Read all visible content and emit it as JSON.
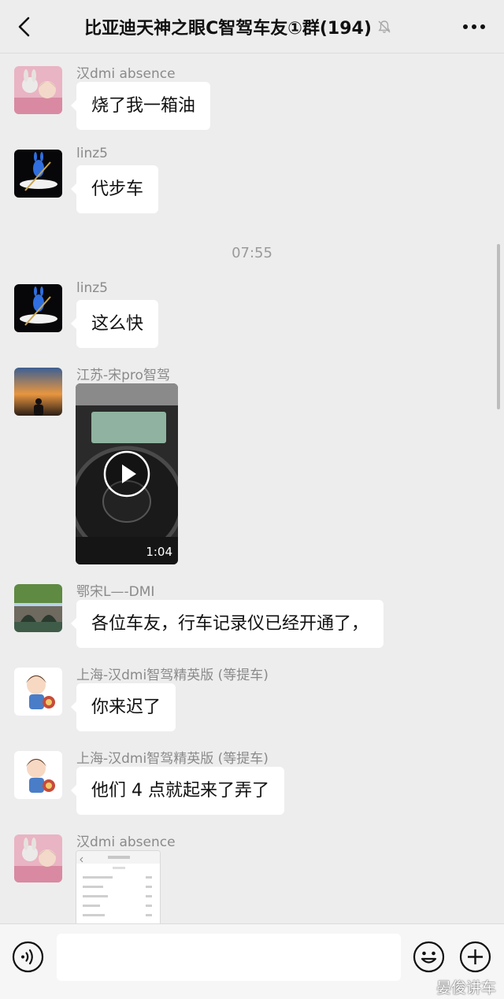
{
  "header": {
    "back_icon": "chevron-left-icon",
    "title": "比亚迪天神之眼C智驾车友①群(194)",
    "mute_icon": "bell-slash-icon",
    "more_icon": "ellipsis-icon"
  },
  "chat": {
    "messages": [
      {
        "sender": "汉dmi absence",
        "avatar": "cartoon-photo-avatar",
        "type": "text",
        "text": "烧了我一箱油"
      },
      {
        "sender": "linz5",
        "avatar": "blue-rabbit-avatar",
        "type": "text",
        "text": "代步车"
      },
      {
        "type": "time",
        "text": "07:55"
      },
      {
        "sender": "linz5",
        "avatar": "blue-rabbit-avatar",
        "type": "text",
        "text": "这么快"
      },
      {
        "sender": "江苏-宋pro智驾",
        "avatar": "sunset-avatar",
        "type": "video",
        "duration": "1:04"
      },
      {
        "sender": "鄂宋L—-DMI",
        "avatar": "stone-bridge-avatar",
        "type": "text",
        "text": "各位车友，行车记录仪已经开通了，"
      },
      {
        "sender": "上海-汉dmi智驾精英版 (等提车)",
        "avatar": "cartoon-boy-avatar",
        "type": "text",
        "text": "你来迟了"
      },
      {
        "sender": "上海-汉dmi智驾精英版 (等提车)",
        "avatar": "cartoon-boy-avatar",
        "type": "text",
        "text": "他们 4 点就起来了弄了"
      },
      {
        "sender": "汉dmi absence",
        "avatar": "cartoon-photo-avatar",
        "type": "image"
      }
    ]
  },
  "input_bar": {
    "voice_icon": "voice-icon",
    "emoji_icon": "emoji-icon",
    "plus_icon": "plus-circle-icon",
    "input_value": ""
  },
  "watermark": "晏俊讲车",
  "colors": {
    "background": "#ededed",
    "bubble": "#ffffff",
    "sender_text": "#8a8a8a",
    "title_text": "#111111"
  }
}
